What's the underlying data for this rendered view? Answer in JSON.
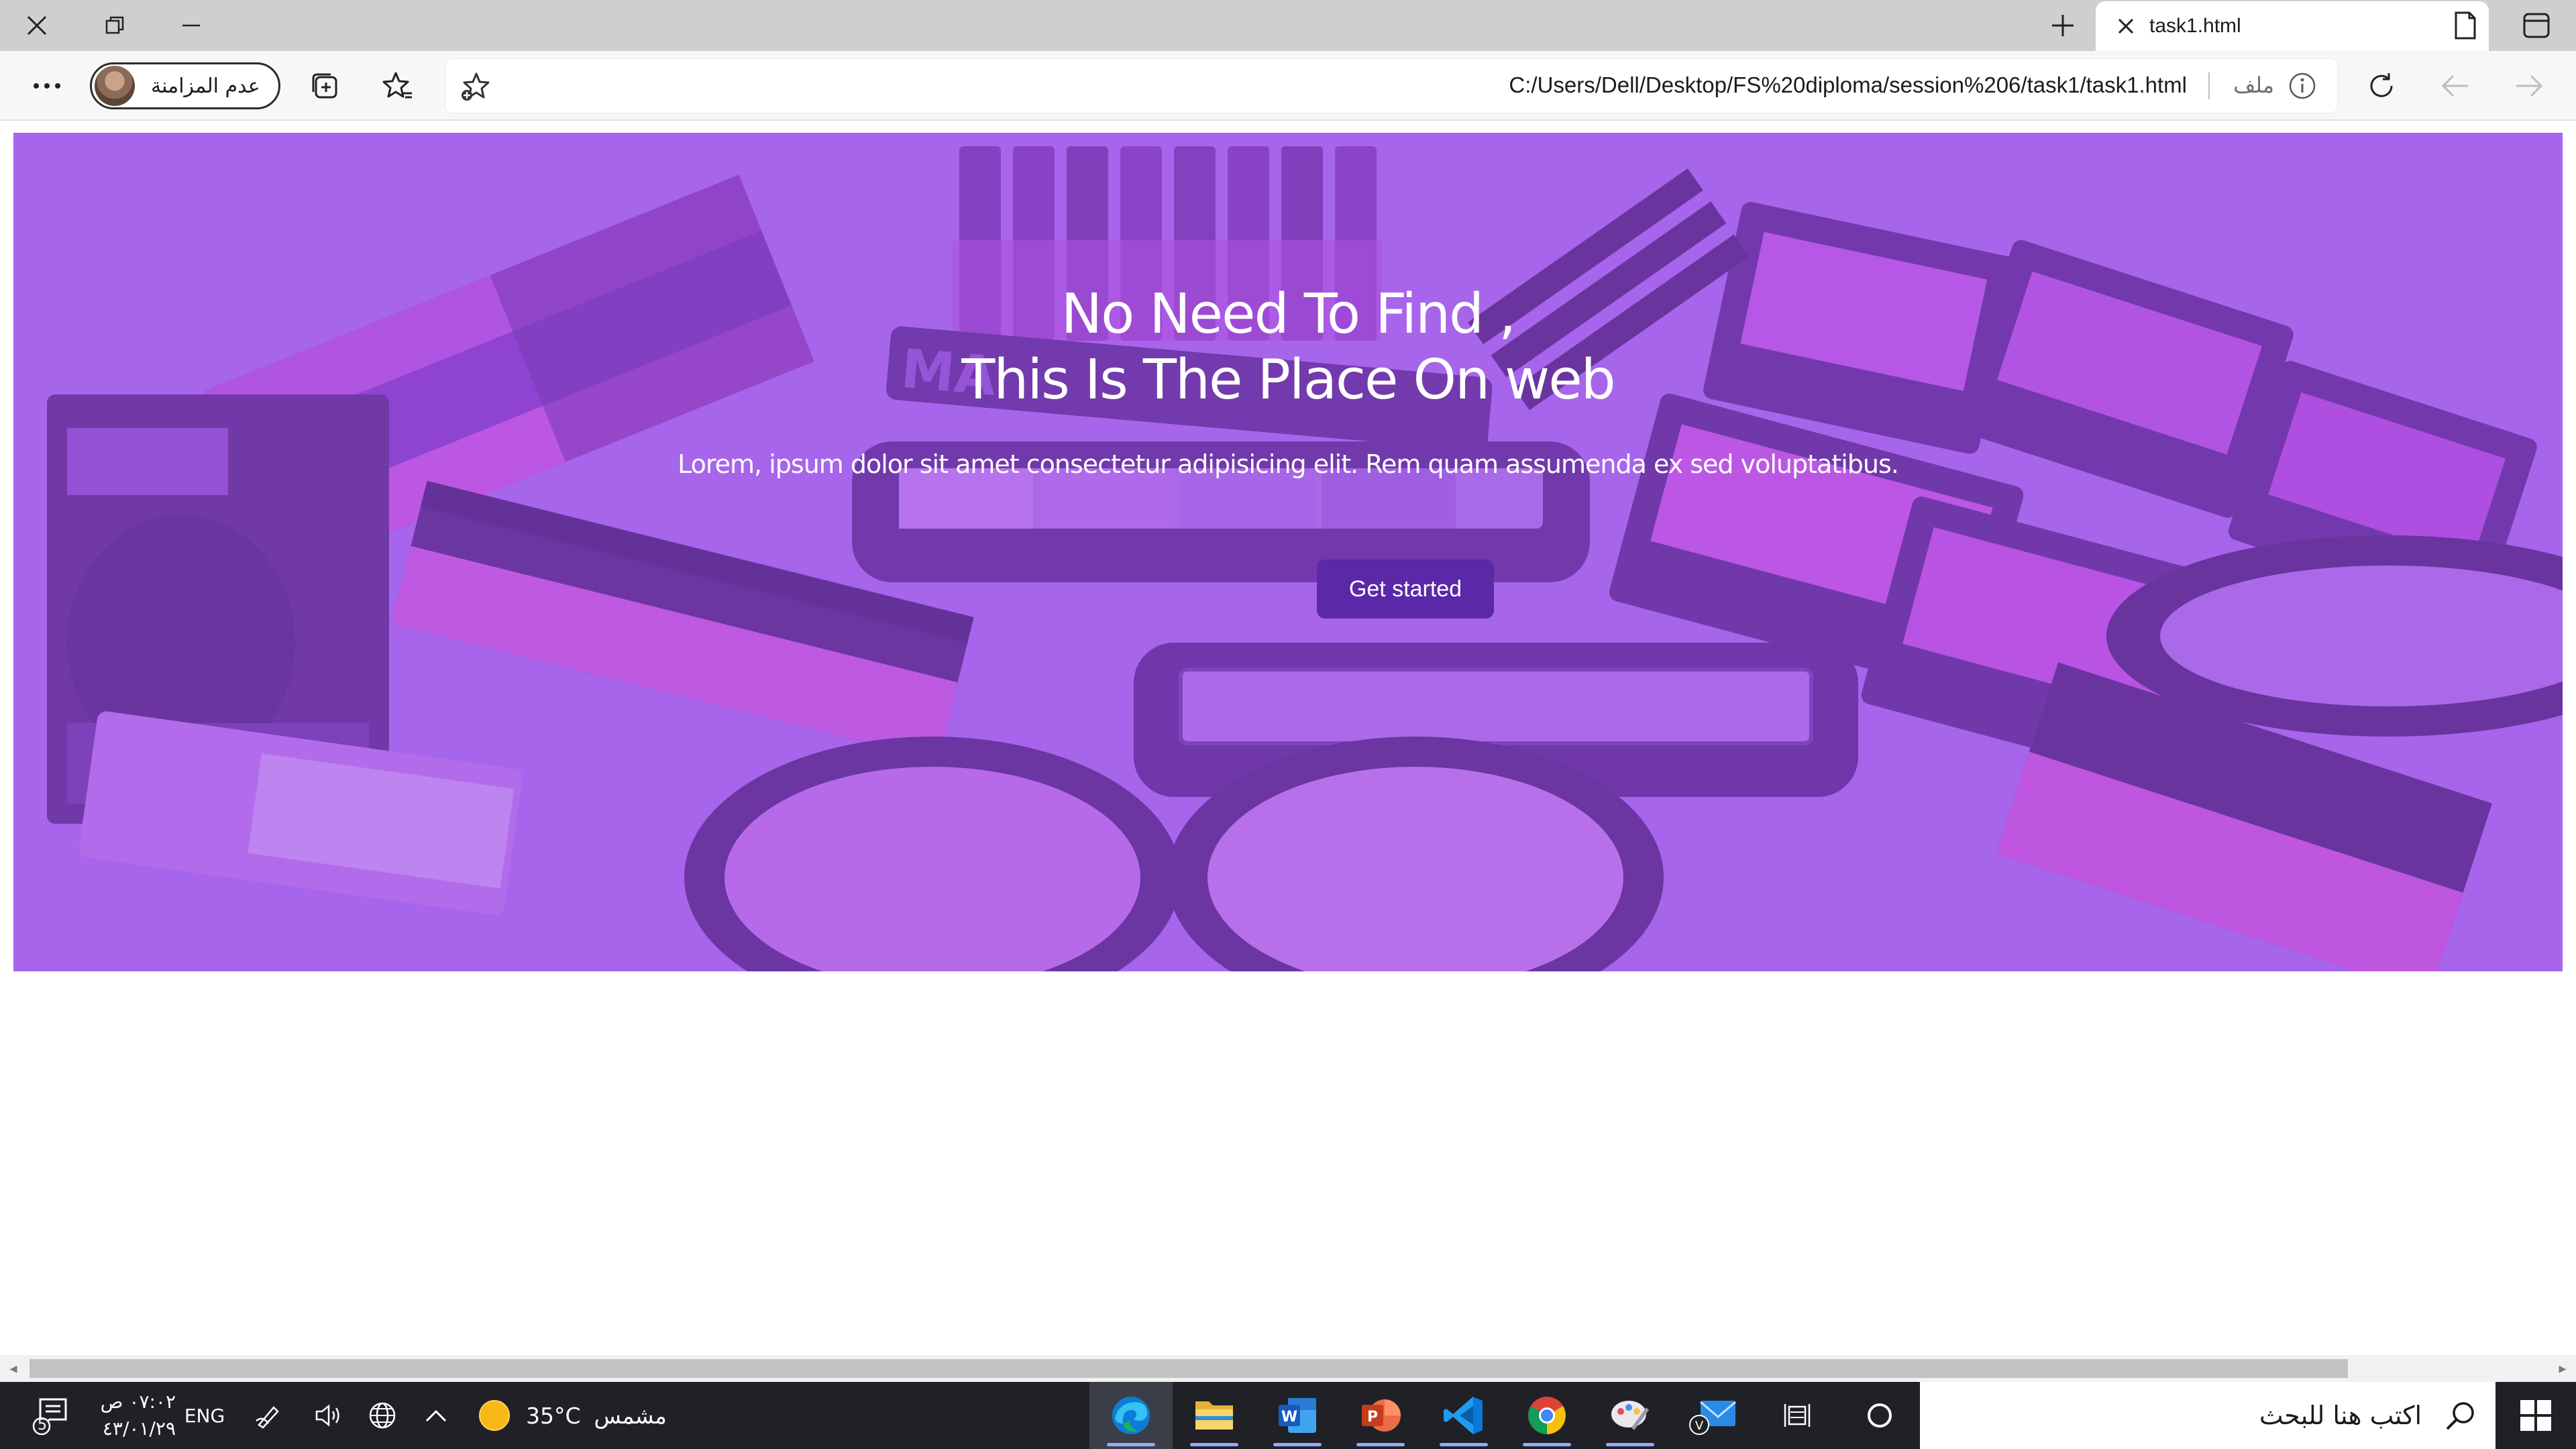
{
  "browser": {
    "tab": {
      "title": "task1.html"
    },
    "address": {
      "url": "C:/Users/Dell/Desktop/FS%20diploma/session%206/task1/task1.html",
      "scheme_label": "ملف"
    },
    "profile": {
      "label": "عدم المزامنة"
    }
  },
  "hero": {
    "title_line1": "No Need To Find ,",
    "title_line2": "This Is The Place On web",
    "text": "Lorem, ipsum dolor sit amet consectetur adipisicing elit. Rem quam assumenda ex sed voluptatibus.",
    "button_label": "Get started"
  },
  "taskbar": {
    "search_placeholder": "اكتب هنا للبحث",
    "weather": {
      "temp": "35°C",
      "condition": "مشمس"
    },
    "language": "ENG",
    "time": "٠٧:٠٢ ص",
    "date": "٤٣/٠١/٢٩",
    "notification_count": "5",
    "apps": [
      "edge-icon",
      "file-explorer-icon",
      "word-icon",
      "powerpoint-icon",
      "vscode-icon",
      "chrome-icon",
      "paint-icon",
      "mail-icon"
    ]
  },
  "colors": {
    "hero_overlay": "#9e50ec",
    "button": "#5b28a8",
    "taskbar": "#1f2126",
    "tabstrip": "#cfcfcf"
  }
}
